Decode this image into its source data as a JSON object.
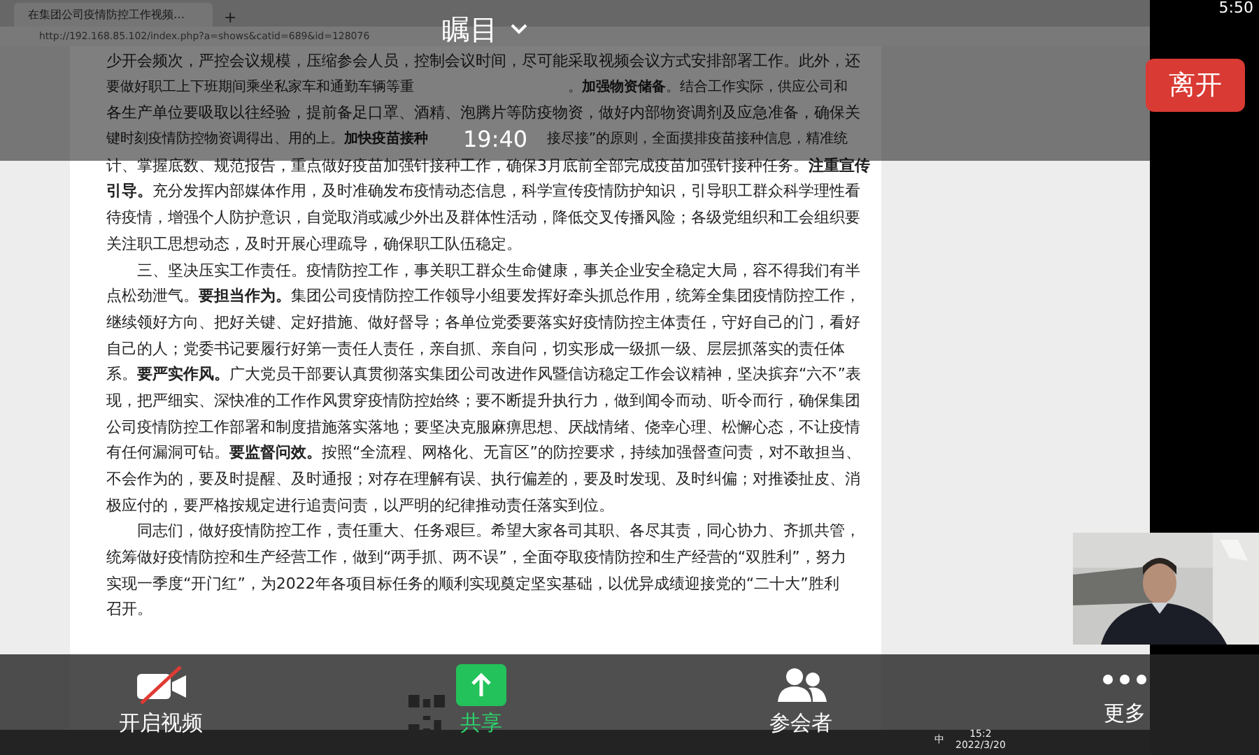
{
  "browser": {
    "tab_title": "在集团公司疫情防控工作视频…",
    "new_tab": "+",
    "url": "http://192.168.85.102/index.php?a=shows&catid=689&id=128076"
  },
  "document": {
    "lines": [
      {
        "indent": false,
        "parts": [
          "少开会频次，严控会议规模，压缩参会人员，控制会议时间，尽可能采取视频会议方式安排部署工作。此外，还"
        ]
      },
      {
        "indent": false,
        "parts": [
          "要做好职工上下班期间乘坐私家车和通勤车辆等重",
          "。**加强物资储备**。结合工作实际，供应公司和"
        ]
      },
      {
        "indent": false,
        "parts": [
          "各生产单位要吸取以往经验，提前备足口罩、酒精、泡腾片等防疫物资，做好内部物资调剂及应急准备，确保关"
        ]
      },
      {
        "indent": false,
        "parts": [
          "键时刻疫情防控物资调得出、用的上。**加快疫苗接种**",
          "接尽接”的原则，全面摸排疫苗接种信息，精准统"
        ]
      },
      {
        "indent": false,
        "parts": [
          "计、掌握底数、规范报告，重点做好疫苗加强针接种工作，确保3月底前全部完成疫苗加强针接种任务。**注重宣传**"
        ]
      },
      {
        "indent": false,
        "parts": [
          "**引导。**充分发挥内部媒体作用，及时准确发布疫情动态信息，科学宣传疫情防护知识，引导职工群众科学理性看"
        ]
      },
      {
        "indent": false,
        "parts": [
          "待疫情，增强个人防护意识，自觉取消或减少外出及群体性活动，降低交叉传播风险；各级党组织和工会组织要"
        ]
      },
      {
        "indent": false,
        "parts": [
          "关注职工思想动态，及时开展心理疏导，确保职工队伍稳定。"
        ]
      },
      {
        "indent": true,
        "parts": [
          "三、坚决压实工作责任。疫情防控工作，事关职工群众生命健康，事关企业安全稳定大局，容不得我们有半"
        ]
      },
      {
        "indent": false,
        "parts": [
          "点松劲泄气。**要担当作为。**集团公司疫情防控工作领导小组要发挥好牵头抓总作用，统筹全集团疫情防控工作，"
        ]
      },
      {
        "indent": false,
        "parts": [
          "继续领好方向、把好关键、定好措施、做好督导；各单位党委要落实好疫情防控主体责任，守好自己的门，看好"
        ]
      },
      {
        "indent": false,
        "parts": [
          "自己的人；党委书记要履行好第一责任人责任，亲自抓、亲自问，切实形成一级抓一级、层层抓落实的责任体"
        ]
      },
      {
        "indent": false,
        "parts": [
          "系。**要严实作风。**广大党员干部要认真贯彻落实集团公司改进作风暨信访稳定工作会议精神，坚决摈弃“六不”表"
        ]
      },
      {
        "indent": false,
        "parts": [
          "现，把严细实、深快准的工作作风贯穿疫情防控始终；要不断提升执行力，做到闻令而动、听令而行，确保集团"
        ]
      },
      {
        "indent": false,
        "parts": [
          "公司疫情防控工作部署和制度措施落实落地；要坚决克服麻痹思想、厌战情绪、侥幸心理、松懈心态，不让疫情"
        ]
      },
      {
        "indent": false,
        "parts": [
          "有任何漏洞可钻。**要监督问效。**按照“全流程、网格化、无盲区”的防控要求，持续加强督查问责，对不敢担当、"
        ]
      },
      {
        "indent": false,
        "parts": [
          "不会作为的，要及时提醒、及时通报；对存在理解有误、执行偏差的，要及时发现、及时纠偏；对推诿扯皮、消"
        ]
      },
      {
        "indent": false,
        "parts": [
          "极应付的，要严格按规定进行追责问责，以严明的纪律推动责任落实到位。"
        ]
      },
      {
        "indent": true,
        "parts": [
          "同志们，做好疫情防控工作，责任重大、任务艰巨。希望大家各司其职、各尽其责，同心协力、齐抓共管，"
        ]
      },
      {
        "indent": false,
        "parts": [
          "统筹做好疫情防控和生产经营工作，做到“两手抓、两不误”，全面夺取疫情防控和生产经营的“双胜利”，努力"
        ]
      },
      {
        "indent": false,
        "parts": [
          "实现一季度“开门红”，为2022年各项目标任务的顺利实现奠定坚实基础，以优异成绩迎接党的“二十大”胜利"
        ]
      },
      {
        "indent": false,
        "parts": [
          "召开。"
        ]
      }
    ]
  },
  "taskbar": {
    "ime": "中",
    "time": "15:2",
    "date": "2022/3/20"
  },
  "meeting": {
    "title": "瞩目",
    "time": "19:40"
  },
  "status_time": "5:50",
  "leave_button": "离开",
  "toolbar": [
    {
      "kind": "video",
      "label": "开启视频"
    },
    {
      "kind": "share",
      "label": "共享"
    },
    {
      "kind": "participants",
      "label": "参会者"
    },
    {
      "kind": "more",
      "label": "更多"
    }
  ]
}
